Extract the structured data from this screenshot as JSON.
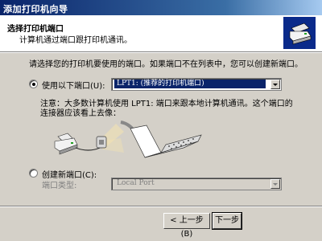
{
  "window": {
    "title": "添加打印机向导"
  },
  "header": {
    "title": "选择打印机端口",
    "subtitle": "计算机通过端口跟打印机通讯。"
  },
  "intro_text": "请选择您的打印机要使用的端口。如果端口不在列表中，您可以创建新端口。",
  "use_port": {
    "label": "使用以下端口",
    "shortcut": "(U):",
    "selected": true,
    "combo_value": "LPT1: (推荐的打印机端口)"
  },
  "note": "注意：大多数计算机使用 LPT1: 端口来跟本地计算机通讯。这个端口的连接器应该看上去像：",
  "create_port": {
    "label": "创建新端口",
    "shortcut": "(C):",
    "selected": false,
    "type_label": "端口类型:",
    "type_value": "Local Port"
  },
  "buttons": {
    "back": "< 上一步(B)",
    "next": "下一步"
  }
}
